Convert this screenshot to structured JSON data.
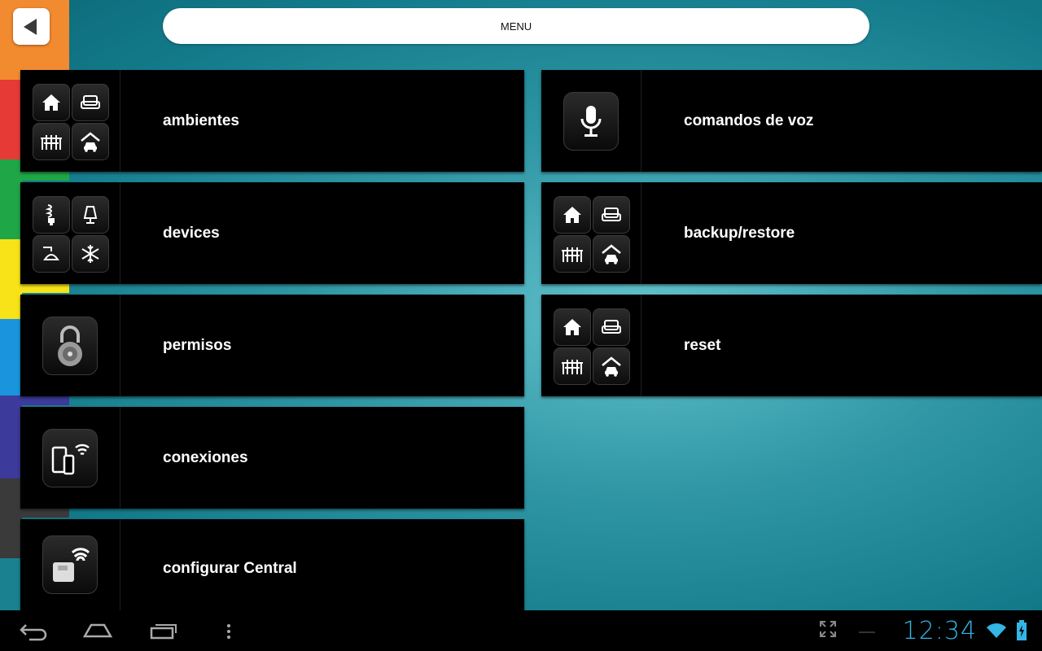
{
  "header": {
    "title": "MENU"
  },
  "menu": {
    "left": [
      {
        "label": "ambientes"
      },
      {
        "label": "devices"
      },
      {
        "label": "permisos"
      },
      {
        "label": "conexiones"
      },
      {
        "label": "configurar Central"
      }
    ],
    "right": [
      {
        "label": "comandos de voz"
      },
      {
        "label": "backup/restore"
      },
      {
        "label": "reset"
      }
    ]
  },
  "icons": {
    "ambientes": [
      "house-icon",
      "sofa-icon",
      "dining-icon",
      "garage-icon"
    ],
    "devices": [
      "bulb-icon",
      "lamp-icon",
      "ceiling-lamp-icon",
      "snowflake-icon"
    ],
    "permisos": "padlock-icon",
    "conexiones": "phones-wifi-icon",
    "configurar_central": "central-wifi-icon",
    "comandos_de_voz": "microphone-icon"
  },
  "status_bar": {
    "time": "12:34"
  },
  "colors": {
    "orange": "#f28a30",
    "red": "#e53a36",
    "green": "#1fa647",
    "yellow": "#f7e318",
    "blue": "#1a95dd",
    "purple": "#3c3a9a",
    "gray": "#3a3a3a",
    "clock": "#33b5e5"
  }
}
